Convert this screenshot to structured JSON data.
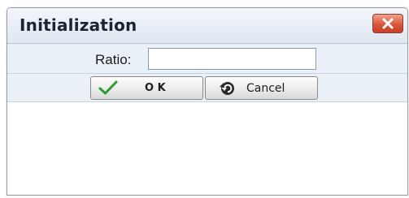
{
  "dialog": {
    "title": "Initialization",
    "close_icon": "close-x-icon"
  },
  "form": {
    "ratio_label": "Ratio:",
    "ratio_value": "",
    "ok_label": "O K",
    "ok_icon": "checkmark-icon",
    "cancel_label": "Cancel",
    "cancel_icon": "undo-icon"
  },
  "colors": {
    "title_text": "#1a2433",
    "row_background": "#eaf0f8",
    "close_button": "#d9563b",
    "check_green": "#2e9b2e"
  }
}
